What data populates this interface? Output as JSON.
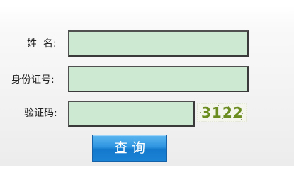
{
  "form": {
    "name_label": "姓  名:",
    "id_label": "身份证号:",
    "captcha_label": "验证码:",
    "name_value": "",
    "id_value": "",
    "captcha_value": "",
    "captcha_text": "3122",
    "submit_label": "查询"
  },
  "colors": {
    "field_background": "#cde9d1",
    "button_background": "#2e95e0",
    "captcha_text": "#6b8c1e"
  }
}
